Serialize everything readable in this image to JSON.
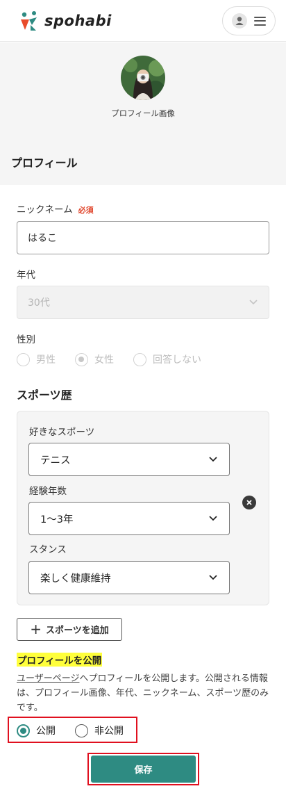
{
  "header": {
    "logo_text": "spohabi",
    "brand_colors": [
      "#e94b2b",
      "#2e8b82"
    ]
  },
  "profile": {
    "image_caption": "プロフィール画像",
    "section_title": "プロフィール"
  },
  "form": {
    "nickname": {
      "label": "ニックネーム",
      "required": "必須",
      "value": "はるこ"
    },
    "age": {
      "label": "年代",
      "value": "30代"
    },
    "gender": {
      "label": "性別",
      "options": [
        "男性",
        "女性",
        "回答しない"
      ],
      "selected": "女性"
    }
  },
  "sports": {
    "section_title": "スポーツ歴",
    "favorite": {
      "label": "好きなスポーツ",
      "value": "テニス"
    },
    "experience": {
      "label": "経験年数",
      "value": "1〜3年"
    },
    "stance": {
      "label": "スタンス",
      "value": "楽しく健康維持"
    },
    "add_button": "スポーツを追加"
  },
  "publish": {
    "title": "プロフィールを公開",
    "desc_link": "ユーザーページ",
    "desc_text": "へプロフィールを公開します。公開される情報は、プロフィール画像、年代、ニックネーム、スポーツ歴のみです。",
    "options": [
      "公開",
      "非公開"
    ],
    "selected": "公開"
  },
  "save_button": "保存",
  "accent_color": "#2e8b82"
}
